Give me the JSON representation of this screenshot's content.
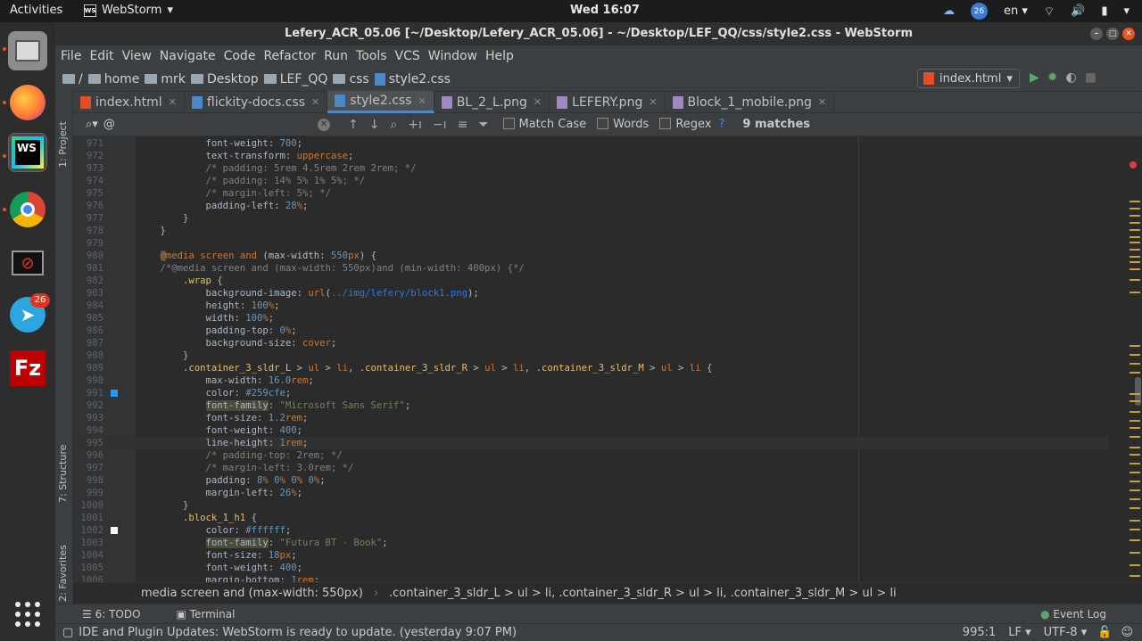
{
  "gnome": {
    "activities": "Activities",
    "app_name": "WebStorm",
    "clock": "Wed 16:07",
    "badge": "26",
    "lang": "en"
  },
  "dock": {
    "telegram_badge": "26"
  },
  "window": {
    "title": "Lefery_ACR_05.06 [~/Desktop/Lefery_ACR_05.06] - ~/Desktop/LEF_QQ/css/style2.css - WebStorm"
  },
  "menu": [
    "File",
    "Edit",
    "View",
    "Navigate",
    "Code",
    "Refactor",
    "Run",
    "Tools",
    "VCS",
    "Window",
    "Help"
  ],
  "nav": {
    "root": "/",
    "crumbs": [
      "home",
      "mrk",
      "Desktop",
      "LEF_QQ",
      "css"
    ],
    "file": "style2.css",
    "run_config": "index.html"
  },
  "tabs": [
    {
      "label": "index.html",
      "color": "#e44d26"
    },
    {
      "label": "flickity-docs.css",
      "color": "#4a88c7"
    },
    {
      "label": "style2.css",
      "color": "#4a88c7",
      "active": true
    },
    {
      "label": "BL_2_L.png",
      "color": "#a287c4"
    },
    {
      "label": "LEFERY.png",
      "color": "#a287c4"
    },
    {
      "label": "Block_1_mobile.png",
      "color": "#a287c4"
    }
  ],
  "sidebar": {
    "project": "1: Project",
    "structure": "7: Structure",
    "favorites": "2: Favorites"
  },
  "find": {
    "query": "@",
    "match_case": "Match Case",
    "words": "Words",
    "regex": "Regex",
    "help": "?",
    "matches": "9 matches"
  },
  "code_lines": [
    {
      "n": "971",
      "t": "            font-weight: 700;"
    },
    {
      "n": "972",
      "t": "            text-transform: uppercase;"
    },
    {
      "n": "973",
      "t": "            /* padding: 5rem 4.5rem 2rem 2rem; */"
    },
    {
      "n": "974",
      "t": "            /* padding: 14% 5% 1% 5%; */"
    },
    {
      "n": "975",
      "t": "            /* margin-left: 5%; */"
    },
    {
      "n": "976",
      "t": "            padding-left: 28%;"
    },
    {
      "n": "977",
      "t": "        }"
    },
    {
      "n": "978",
      "t": "    }"
    },
    {
      "n": "979",
      "t": ""
    },
    {
      "n": "980",
      "t": "    @media screen and (max-width: 550px) {"
    },
    {
      "n": "981",
      "t": "    /*@media screen and (max-width: 550px)and (min-width: 400px) {*/"
    },
    {
      "n": "982",
      "t": "        .wrap {"
    },
    {
      "n": "983",
      "t": "            background-image: url(../img/lefery/block1.png);"
    },
    {
      "n": "984",
      "t": "            height: 100%;"
    },
    {
      "n": "985",
      "t": "            width: 100%;"
    },
    {
      "n": "986",
      "t": "            padding-top: 0%;"
    },
    {
      "n": "987",
      "t": "            background-size: cover;"
    },
    {
      "n": "988",
      "t": "        }"
    },
    {
      "n": "989",
      "t": "        .container_3_sldr_L > ul > li, .container_3_sldr_R > ul > li, .container_3_sldr_M > ul > li {"
    },
    {
      "n": "990",
      "t": "            max-width: 16.0rem;"
    },
    {
      "n": "991",
      "t": "            color: #259cfe;"
    },
    {
      "n": "992",
      "t": "            font-family: \"Microsoft Sans Serif\";"
    },
    {
      "n": "993",
      "t": "            font-size: 1.2rem;"
    },
    {
      "n": "994",
      "t": "            font-weight: 400;"
    },
    {
      "n": "995",
      "t": "            line-height: 1rem;"
    },
    {
      "n": "996",
      "t": "            /* padding-top: 2rem; */"
    },
    {
      "n": "997",
      "t": "            /* margin-left: 3.0rem; */"
    },
    {
      "n": "998",
      "t": "            padding: 8% 0% 0% 0%;"
    },
    {
      "n": "999",
      "t": "            margin-left: 26%;"
    },
    {
      "n": "1000",
      "t": "        }"
    },
    {
      "n": "1001",
      "t": "        .block_1_h1 {"
    },
    {
      "n": "1002",
      "t": "            color: #ffffff;"
    },
    {
      "n": "1003",
      "t": "            font-family: \"Futura BT - Book\";"
    },
    {
      "n": "1004",
      "t": "            font-size: 18px;"
    },
    {
      "n": "1005",
      "t": "            font-weight: 400;"
    },
    {
      "n": "1006",
      "t": "            margin-bottom: 1rem;"
    }
  ],
  "breadcrumb": [
    "media screen and (max-width: 550px)",
    ".container_3_sldr_L > ul > li, .container_3_sldr_R > ul > li, .container_3_sldr_M > ul > li"
  ],
  "toolwindows": {
    "todo": "6: TODO",
    "terminal": "Terminal",
    "event_log": "Event Log"
  },
  "status": {
    "message": "IDE and Plugin Updates: WebStorm is ready to update. (yesterday 9:07 PM)",
    "position": "995:1",
    "line_sep": "LF",
    "encoding": "UTF-8"
  }
}
